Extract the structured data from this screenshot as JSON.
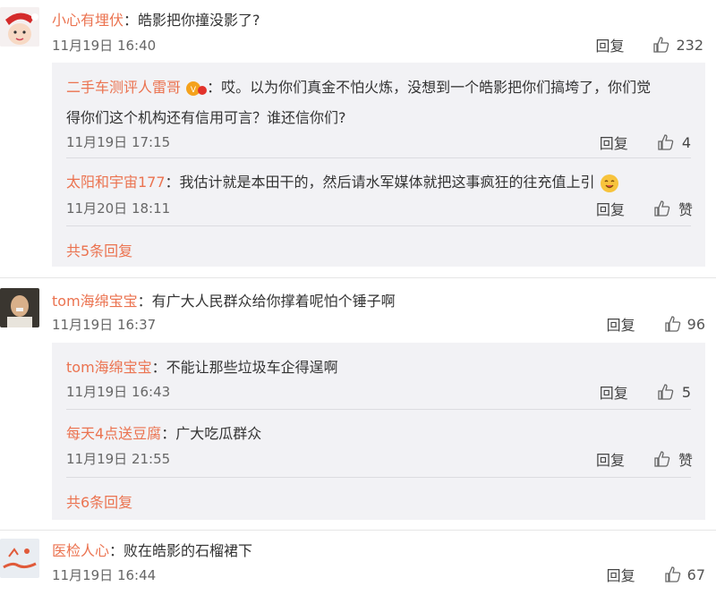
{
  "comments": [
    {
      "user": "小心有埋伏",
      "text": "：皓影把你撞没影了?",
      "time": "11月19日 16:40",
      "reply": "回复",
      "likes": "232",
      "replies": [
        {
          "user": "二手车测评人雷哥",
          "text1": "：哎。以为你们真金不怕火炼，没想到一个皓影把你们搞垮了，你们觉",
          "text2": "得你们这个机构还有信用可言？谁还信你们?",
          "time": "11月19日 17:15",
          "reply": "回复",
          "likes": "4"
        },
        {
          "user": "太阳和宇宙177",
          "text1": "：我估计就是本田干的，然后请水军媒体就把这事疯狂的往充值上引",
          "time": "11月20日 18:11",
          "reply": "回复",
          "likes": "赞"
        }
      ],
      "more": "共5条回复"
    },
    {
      "user": "tom海绵宝宝",
      "text": "：有广大人民群众给你撑着呢怕个锤子啊",
      "time": "11月19日 16:37",
      "reply": "回复",
      "likes": "96",
      "replies": [
        {
          "user": "tom海绵宝宝",
          "text1": "：不能让那些垃圾车企得逞啊",
          "time": "11月19日 16:43",
          "reply": "回复",
          "likes": "5"
        },
        {
          "user": "每天4点送豆腐",
          "text1": "：广大吃瓜群众",
          "time": "11月19日 21:55",
          "reply": "回复",
          "likes": "赞"
        }
      ],
      "more": "共6条回复"
    },
    {
      "user": "医检人心",
      "text": "：败在皓影的石榴裙下",
      "time": "11月19日 16:44",
      "reply": "回复",
      "likes": "67"
    }
  ],
  "icons": {
    "like": "thumbs-up-icon",
    "badge": "vip-badge-icon",
    "emoji": "yum-emoji-icon"
  },
  "colors": {
    "username": "#eb7350",
    "sub_bg": "#f2f2f5"
  }
}
